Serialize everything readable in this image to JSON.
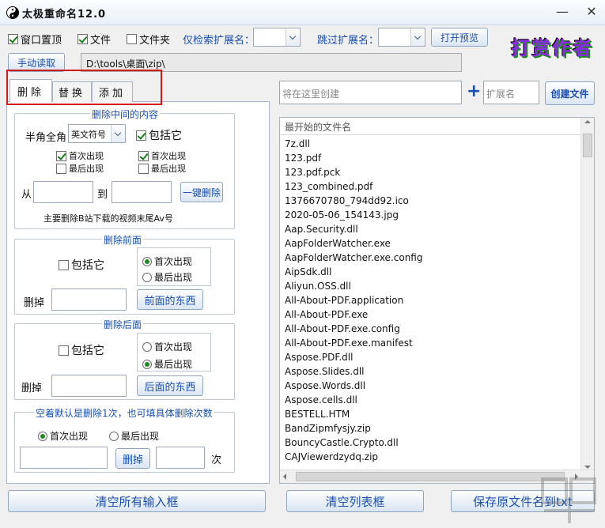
{
  "title": "太极重命名12.0",
  "window_controls": {
    "minimize": "—",
    "close": "✕"
  },
  "toolbar": {
    "window_top": "窗口置顶",
    "file": "文件",
    "folder": "文件夹",
    "only_ext_label": "仅检索扩展名：",
    "skip_ext_label": "跳过扩展名：",
    "open_preview": "打开预览",
    "manual_read": "手动读取",
    "path": "D:\\tools\\桌面\\zip\\",
    "logo": "打赏作者"
  },
  "tabs": [
    "删除",
    "替换",
    "添加"
  ],
  "delete_middle": {
    "title": "删除中间的内容",
    "half_full_label": "半角全角",
    "half_full_value": "英文符号",
    "include": "包括它",
    "first1": "首次出现",
    "last1": "最后出现",
    "first2": "首次出现",
    "last2": "最后出现",
    "from": "从",
    "to": "到",
    "one_key": "一键删除",
    "note": "主要删除B站下载的视频末尾Av号"
  },
  "delete_front": {
    "title": "删除前面",
    "include": "包括它",
    "first": "首次出现",
    "last": "最后出现",
    "delete_label": "删掉",
    "button": "前面的东西"
  },
  "delete_back": {
    "title": "删除后面",
    "include": "包括它",
    "first": "首次出现",
    "last": "最后出现",
    "delete_label": "删掉",
    "button": "后面的东西"
  },
  "delete_count": {
    "title": "空着默认是删除1次，也可填具体删除次数",
    "first": "首次出现",
    "last": "最后出现",
    "button": "删掉",
    "times": "次"
  },
  "create": {
    "placeholder": "将在这里创建",
    "plus": "+",
    "ext_placeholder": "扩展名",
    "button": "创建文件"
  },
  "list": {
    "header": "最开始的文件名",
    "items": [
      "7z.dll",
      "123.pdf",
      "123.pdf.pck",
      "123_combined.pdf",
      "1376670780_794dd92.ico",
      "2020-05-06_154143.jpg",
      "Aap.Security.dll",
      "AapFolderWatcher.exe",
      "AapFolderWatcher.exe.config",
      "AipSdk.dll",
      "Aliyun.OSS.dll",
      "All-About-PDF.application",
      "All-About-PDF.exe",
      "All-About-PDF.exe.config",
      "All-About-PDF.exe.manifest",
      "Aspose.PDF.dll",
      "Aspose.Slides.dll",
      "Aspose.Words.dll",
      "Aspose.cells.dll",
      "BESTELL.HTM",
      "BandZipmfysjy.zip",
      "BouncyCastle.Crypto.dll",
      "CAJViewerdzydq.zip"
    ]
  },
  "bottom": {
    "clear_inputs": "清空所有输入框",
    "clear_list": "清空列表框",
    "save_txt": "保存原文件名到txt"
  }
}
